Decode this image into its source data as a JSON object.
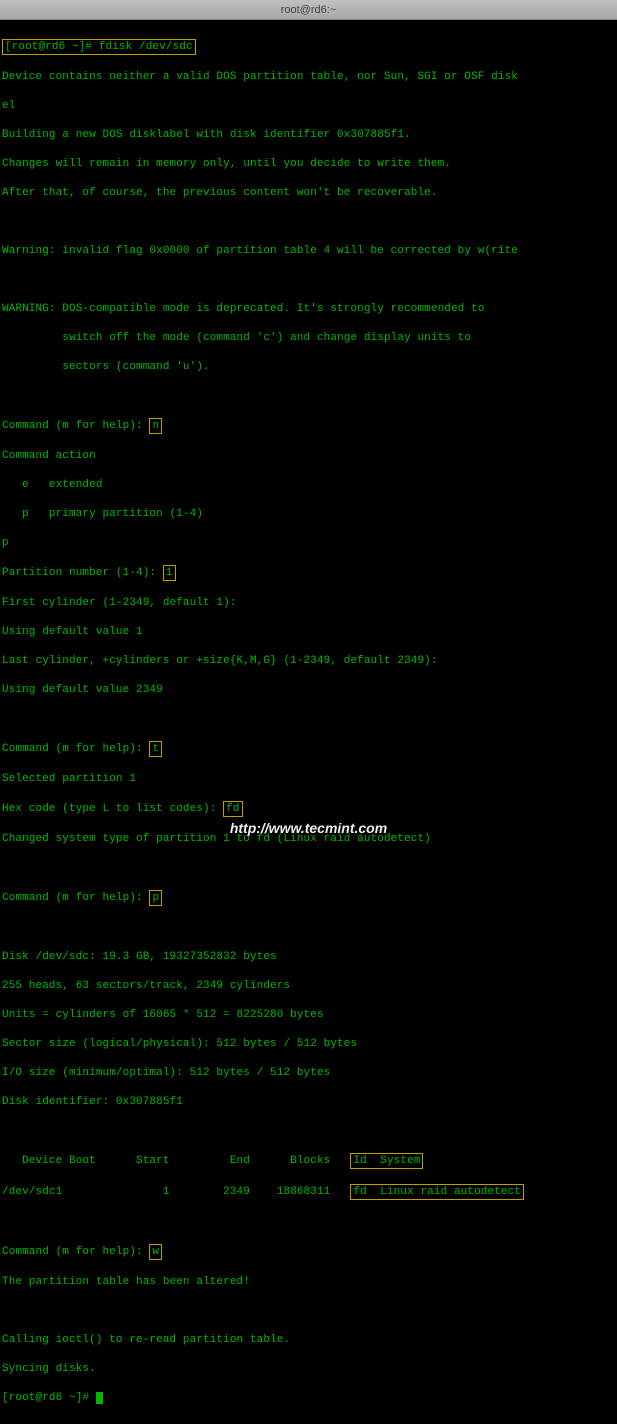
{
  "titlebar": {
    "title": "root@rd6:~"
  },
  "term": {
    "prompt1_host": "[root@rd6 ~]",
    "prompt1_sym": "# ",
    "cmd1": "fdisk /dev/sdc",
    "out": {
      "l1": "Device contains neither a valid DOS partition table, nor Sun, SGI or OSF disk",
      "l2": "el",
      "l3": "Building a new DOS disklabel with disk identifier 0x307885f1.",
      "l4": "Changes will remain in memory only, until you decide to write them.",
      "l5": "After that, of course, the previous content won't be recoverable.",
      "l6": "Warning: invalid flag 0x0000 of partition table 4 will be corrected by w(rite",
      "l7": "WARNING: DOS-compatible mode is deprecated. It's strongly recommended to",
      "l8": "         switch off the mode (command 'c') and change display units to",
      "l9": "         sectors (command 'u').",
      "cmdp1": "Command (m for help): ",
      "in_n": "n",
      "ca": "Command action",
      "ca_e": "   e   extended",
      "ca_p": "   p   primary partition (1-4)",
      "p": "p",
      "pn": "Partition number (1-4): ",
      "in_1": "1",
      "fc": "First cylinder (1-2349, default 1):",
      "udv1": "Using default value 1",
      "lc": "Last cylinder, +cylinders or +size{K,M,G} (1-2349, default 2349):",
      "udv2": "Using default value 2349",
      "cmdp2": "Command (m for help): ",
      "in_t": "t",
      "sp1": "Selected partition 1",
      "hex": "Hex code (type L to list codes): ",
      "in_fd": "fd",
      "cst": "Changed system type of partition 1 to fd (Linux raid autodetect)",
      "cmdp3": "Command (m for help): ",
      "in_p": "p",
      "disk": "Disk /dev/sdc: 19.3 GB, 19327352832 bytes",
      "geom": "255 heads, 63 sectors/track, 2349 cylinders",
      "units": "Units = cylinders of 16065 * 512 = 8225280 bytes",
      "ssize": "Sector size (logical/physical): 512 bytes / 512 bytes",
      "iosize": "I/O size (minimum/optimal): 512 bytes / 512 bytes",
      "did": "Disk identifier: 0x307885f1",
      "thdr1": "   Device Boot      Start         End      Blocks   ",
      "thdr2": "Id  System",
      "trow1": "/dev/sdc1               1        2349    18868311   ",
      "trow2": "fd  Linux raid autodetect",
      "cmdp4": "Command (m for help): ",
      "in_w": "w",
      "alt": "The partition table has been altered!",
      "ioctl": "Calling ioctl() to re-read partition table.",
      "sync": "Syncing disks.",
      "prompt2_host": "[root@rd6 ~]",
      "prompt2_sym": "# "
    }
  },
  "watermark": "http://www.tecmint.com"
}
